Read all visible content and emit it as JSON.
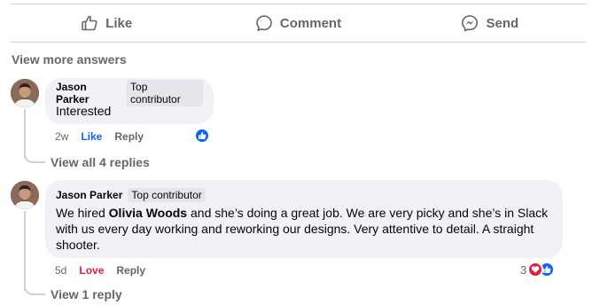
{
  "actions": {
    "like_label": "Like",
    "comment_label": "Comment",
    "send_label": "Send"
  },
  "view_more_label": "View more answers",
  "comments": [
    {
      "author": "Jason Parker",
      "badge": "Top contributor",
      "text": "Interested",
      "time": "2w",
      "reaction_action": "Like",
      "reply_label": "Reply",
      "replies_label": "View all 4 replies",
      "reaction_icons": [
        "like-icon"
      ]
    },
    {
      "author": "Jason Parker",
      "badge": "Top contributor",
      "text_before": "We hired ",
      "mention": "Olivia Woods",
      "text_after": " and she’s doing a great job. We are very picky and she’s in Slack with us every day working and reworking our designs. Very attentive to detail. A straight shooter.",
      "time": "5d",
      "reaction_action": "Love",
      "reply_label": "Reply",
      "reaction_count": "3",
      "replies_label": "View 1 reply",
      "reaction_icons": [
        "love-icon",
        "like-icon"
      ]
    }
  ],
  "colors": {
    "like_blue": "#0866ff",
    "love_red": "#e41e3f",
    "muted_text": "#65676b",
    "bubble_bg": "#f0f2f5"
  }
}
